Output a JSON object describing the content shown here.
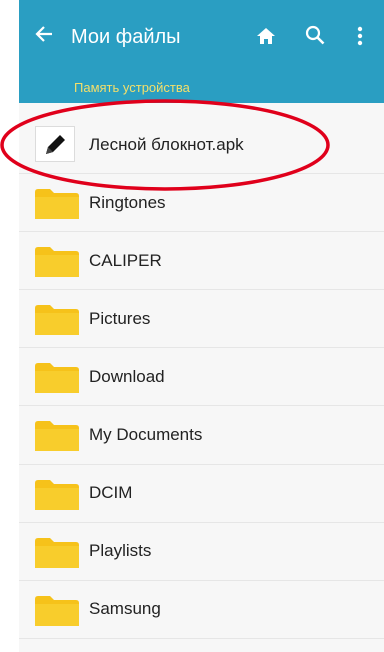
{
  "header": {
    "title": "Мои файлы",
    "breadcrumb": "Память устройства",
    "icons": [
      "back-arrow-icon",
      "home-icon",
      "search-icon",
      "more-vert-icon"
    ]
  },
  "files": [
    {
      "label": "Лесной блокнот.apk",
      "icon": "pencil-icon",
      "highlighted": true
    },
    {
      "label": "Ringtones",
      "icon": "folder-icon"
    },
    {
      "label": "CALIPER",
      "icon": "folder-icon"
    },
    {
      "label": "Pictures",
      "icon": "folder-icon"
    },
    {
      "label": "Download",
      "icon": "folder-icon"
    },
    {
      "label": "My Documents",
      "icon": "folder-icon"
    },
    {
      "label": "DCIM",
      "icon": "folder-icon"
    },
    {
      "label": "Playlists",
      "icon": "folder-icon"
    },
    {
      "label": "Samsung",
      "icon": "folder-icon"
    }
  ],
  "colors": {
    "appbar": "#2a9ec2",
    "breadcrumb": "#f4df6a",
    "folder": "#f6c21a",
    "highlight_ring": "#e0001b"
  }
}
